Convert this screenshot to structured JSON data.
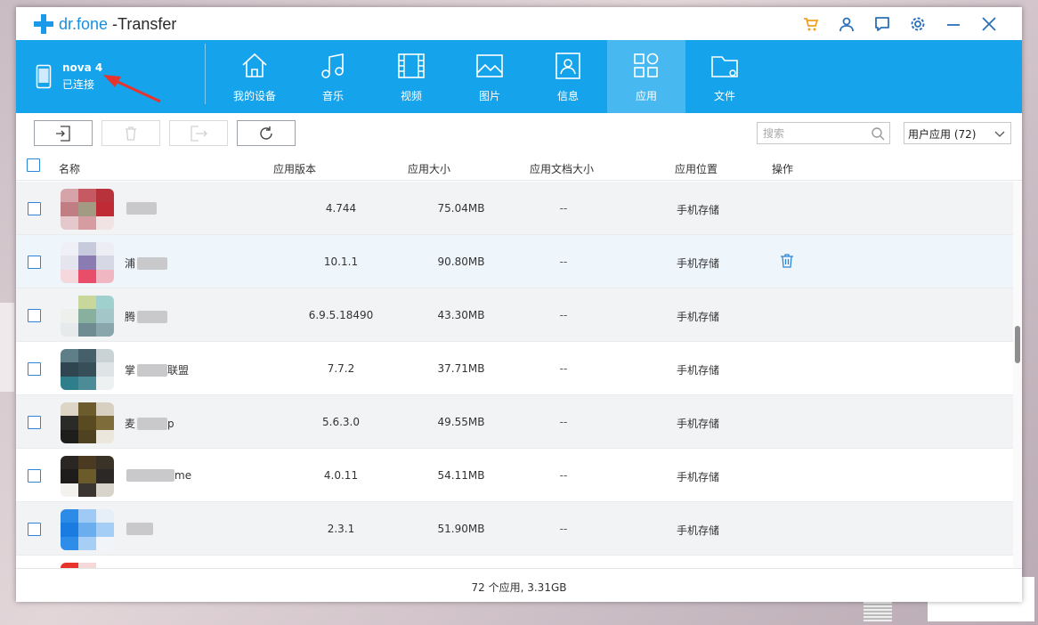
{
  "app": {
    "brand": "dr.fone",
    "title_suffix": " -Transfer"
  },
  "colors": {
    "header_blue": "#15a4ec",
    "active_tab": "#47b8f0",
    "cart_orange": "#f0a020",
    "icon_blue": "#2b86d9",
    "annotation_red": "#e8322c"
  },
  "device": {
    "name": "nova 4",
    "status": "已连接"
  },
  "nav": {
    "items": [
      {
        "label": "我的设备",
        "icon": "home-icon"
      },
      {
        "label": "音乐",
        "icon": "music-icon"
      },
      {
        "label": "视频",
        "icon": "video-icon"
      },
      {
        "label": "图片",
        "icon": "image-icon"
      },
      {
        "label": "信息",
        "icon": "contact-icon"
      },
      {
        "label": "应用",
        "icon": "apps-icon",
        "active": true
      },
      {
        "label": "文件",
        "icon": "folder-icon"
      }
    ]
  },
  "toolbar": {
    "search_placeholder": "搜索",
    "filter_selected": "用户应用 (72)"
  },
  "table": {
    "headers": {
      "name": "名称",
      "version": "应用版本",
      "size": "应用大小",
      "doc_size": "应用文档大小",
      "location": "应用位置",
      "action": "操作"
    },
    "rows": [
      {
        "name_prefix": "",
        "name_suffix": "",
        "version": "4.744",
        "size": "75.04MB",
        "doc_size": "--",
        "location": "手机存储"
      },
      {
        "name_prefix": "浦",
        "name_suffix": "",
        "version": "10.1.1",
        "size": "90.80MB",
        "doc_size": "--",
        "location": "手机存储"
      },
      {
        "name_prefix": "腾",
        "name_suffix": "",
        "version": "6.9.5.18490",
        "size": "43.30MB",
        "doc_size": "--",
        "location": "手机存储"
      },
      {
        "name_prefix": "掌",
        "name_suffix": "联盟",
        "version": "7.7.2",
        "size": "37.71MB",
        "doc_size": "--",
        "location": "手机存储"
      },
      {
        "name_prefix": "麦",
        "name_suffix": "p",
        "version": "5.6.3.0",
        "size": "49.55MB",
        "doc_size": "--",
        "location": "手机存储"
      },
      {
        "name_prefix": "",
        "name_suffix": "me",
        "version": "4.0.11",
        "size": "54.11MB",
        "doc_size": "--",
        "location": "手机存储"
      },
      {
        "name_prefix": "",
        "name_suffix": "",
        "version": "2.3.1",
        "size": "51.90MB",
        "doc_size": "--",
        "location": "手机存储"
      }
    ]
  },
  "footer": {
    "summary": "72 个应用, 3.31GB"
  }
}
